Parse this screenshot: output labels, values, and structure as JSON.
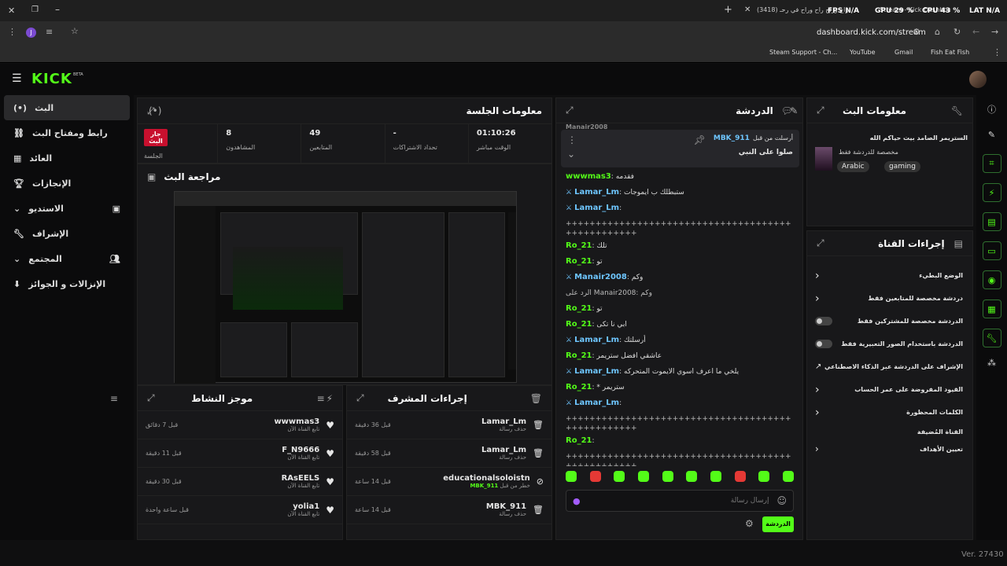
{
  "browser": {
    "tabs": [
      {
        "label": "Stream - Kick Dashboard"
      },
      {
        "label": "راح وراح راح وراح في رحـ (3418)"
      }
    ],
    "perf": {
      "fps": "FPS N/A",
      "gpu": "GPU 29 %",
      "cpu": "CPU 43 %",
      "lat": "LAT N/A"
    },
    "url": "dashboard.kick.com/stream",
    "bookmarks": [
      "Steam Support - Ch...",
      "YouTube",
      "Gmail",
      "Fish Eat Fish"
    ]
  },
  "app": {
    "logo": "KICK",
    "beta": "BETA",
    "version": "Ver. 27430"
  },
  "sidebar": {
    "items": [
      {
        "label": "البث"
      },
      {
        "label": "رابط ومفتاح البث"
      },
      {
        "label": "العائد"
      },
      {
        "label": "الإنجازات"
      },
      {
        "label": "الاستديو"
      },
      {
        "label": "الإشراف"
      },
      {
        "label": "المجتمع"
      },
      {
        "label": "الإنزالات و الجوائز"
      }
    ]
  },
  "session": {
    "title": "معلومات الجلسة",
    "live_badge": "جار البث",
    "session_label": "الجلسة",
    "viewers": {
      "value": "8",
      "label": "المشاهدون"
    },
    "followers": {
      "value": "49",
      "label": "المتابعين"
    },
    "subs": {
      "value": "-",
      "label": "تحداد الاشتراكات"
    },
    "time": {
      "value": "01:10:26",
      "label": "الوقت مباشر"
    }
  },
  "preview": {
    "title": "مراجعة البث"
  },
  "activity": {
    "title": "موجز النشاط",
    "items": [
      {
        "user": "wwwmas3",
        "sub": "تابع القناة الآن",
        "time": "قبل 7 دقائق"
      },
      {
        "user": "F_N9666",
        "sub": "تابع القناة الآن",
        "time": "قبل 11 دقيقة"
      },
      {
        "user": "RAsEELS",
        "sub": "تابع القناة الآن",
        "time": "قبل 30 دقيقة"
      },
      {
        "user": "yolia1",
        "sub": "تابع القناة الآن",
        "time": "قبل ساعة واحدة"
      }
    ]
  },
  "modactions": {
    "title": "إجراءات المشرف",
    "items": [
      {
        "user": "Lamar_Lm",
        "sub": "حذف رسالة",
        "time": "قبل 36 دقيقة"
      },
      {
        "user": "Lamar_Lm",
        "sub": "حذف رسالة",
        "time": "قبل 58 دقيقة"
      },
      {
        "user": "educationalsoloistn",
        "sub": "خطر من قبل",
        "by": "MBK_911",
        "time": "قبل 14 ساعة"
      },
      {
        "user": "MBK_911",
        "sub": "حذف رسالة",
        "time": "قبل 14 ساعة"
      }
    ]
  },
  "chat": {
    "title": "الدردشة",
    "pinned_by_label": "أرسلت من قبل",
    "pinned_by": "MBK_911",
    "pinned_msg": "صلوا على النبي",
    "top_user": "Manair2008",
    "messages": [
      {
        "user": "wwwmas3",
        "text": "فقدمه",
        "mod": false
      },
      {
        "user": "Lamar_Lm",
        "text": "ستبطلك ب ايموجات",
        "mod": true
      },
      {
        "user": "Lamar_Lm",
        "text": "",
        "mod": true
      },
      {
        "user": "",
        "text": "++++++++++++++++++++++++++++++++++++++++++++++++++",
        "mod": false
      },
      {
        "user": "Ro_21",
        "text": "تلك",
        "mod": false
      },
      {
        "user": "Ro_21",
        "text": "تو",
        "mod": false
      },
      {
        "user": "Manair2008",
        "text": "وكم",
        "mod": true
      },
      {
        "user": "",
        "text": "الرد على Manair2008: وكم",
        "mod": false
      },
      {
        "user": "Ro_21",
        "text": "تو",
        "mod": false
      },
      {
        "user": "Ro_21",
        "text": "ابي نا تكى",
        "mod": false
      },
      {
        "user": "Lamar_Lm",
        "text": "أرسلتك",
        "mod": true
      },
      {
        "user": "Ro_21",
        "text": "عاشقي افضل ستريمر",
        "mod": false
      },
      {
        "user": "Lamar_Lm",
        "text": "يلخي ما اعرف اسوي الايموت المتحركه",
        "mod": true
      },
      {
        "user": "Ro_21",
        "text": "* ستريمر",
        "mod": false
      },
      {
        "user": "Lamar_Lm",
        "text": "",
        "mod": true
      },
      {
        "user": "",
        "text": "++++++++++++++++++++++++++++++++++++++++++++++++++",
        "mod": false
      },
      {
        "user": "Ro_21",
        "text": "",
        "mod": false
      },
      {
        "user": "",
        "text": "++++++++++++++++++++++++++++++++++++++++++++++++++",
        "mod": false
      }
    ],
    "input_placeholder": "إرسال رسالة",
    "send_label": "الدردشة"
  },
  "streaminfo": {
    "title": "معلومات البث",
    "stream_title": "الستريمر الصامد بيت حياكم الله",
    "category": "مخصصة للدردشة فقط",
    "tags": [
      "Arabic",
      "gaming"
    ]
  },
  "channel": {
    "title": "إجراءات القناة",
    "items": [
      {
        "label": "الوضع البطيء",
        "control": "arrow"
      },
      {
        "label": "دردشة مخصصة للمتابعين فقط",
        "control": "arrow"
      },
      {
        "label": "الدردشة مخصصة للمشتركين فقط",
        "control": "toggle"
      },
      {
        "label": "الدردشة باستخدام الصور التعبيرية فقط",
        "control": "toggle"
      },
      {
        "label": "الإشراف على الدردشة عبر الذكاء الاصطناعي",
        "control": "link"
      },
      {
        "label": "القيود المفروضة على عمر الحساب",
        "control": "arrow"
      },
      {
        "label": "الكلمات المحظورة",
        "control": "arrow"
      }
    ],
    "section": "القناة المُضيفة",
    "goals": "تعيين الأهداف"
  }
}
